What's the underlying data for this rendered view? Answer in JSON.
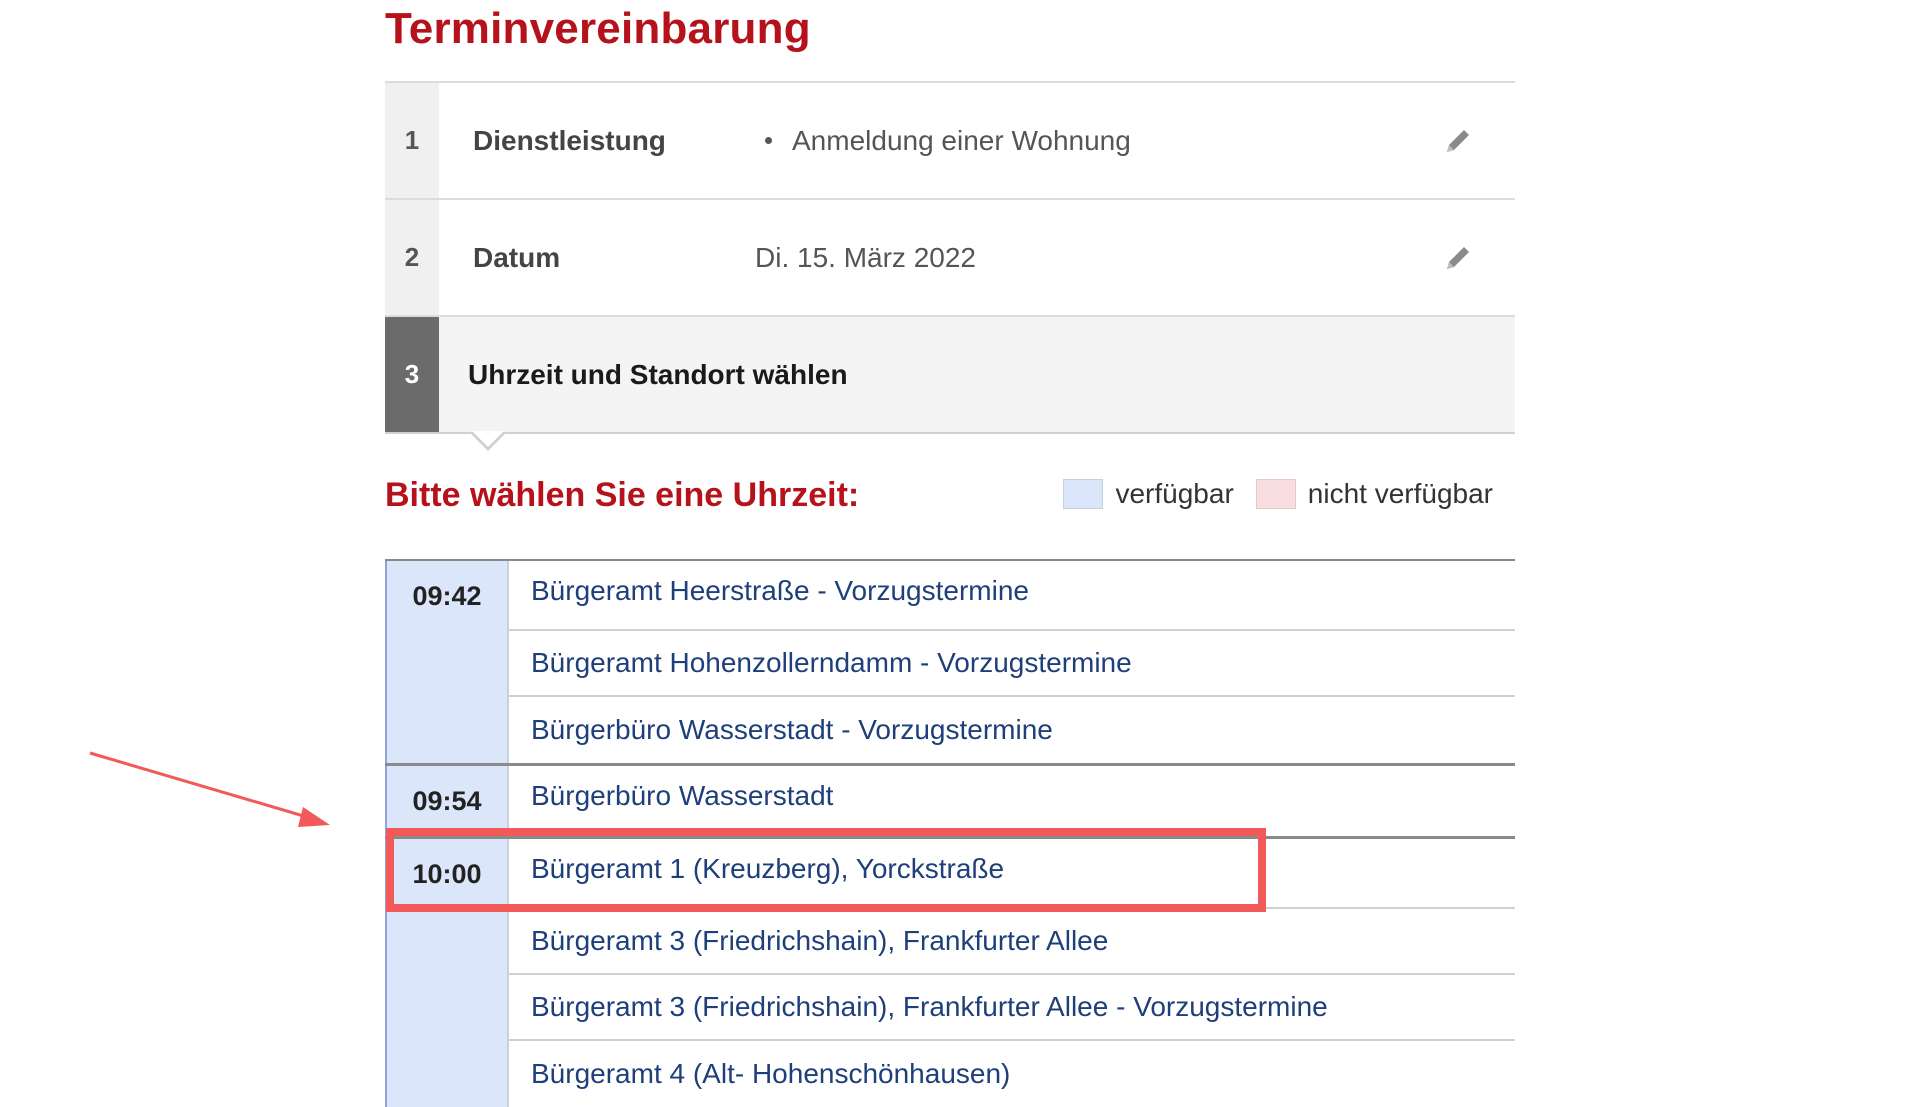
{
  "page": {
    "title": "Terminvereinbarung"
  },
  "steps": [
    {
      "number": "1",
      "label": "Dienstleistung",
      "value": "Anmeldung einer Wohnung"
    },
    {
      "number": "2",
      "label": "Datum",
      "value": "Di. 15. März 2022"
    },
    {
      "number": "3",
      "label": "Uhrzeit und Standort wählen"
    }
  ],
  "selection": {
    "heading": "Bitte wählen Sie eine Uhrzeit:",
    "legend": {
      "available": "verfügbar",
      "unavailable": "nicht verfügbar"
    }
  },
  "slots": [
    {
      "time": "09:42",
      "places": [
        "Bürgeramt Heerstraße - Vorzugstermine",
        "Bürgeramt Hohenzollerndamm - Vorzugstermine",
        "Bürgerbüro Wasserstadt - Vorzugstermine"
      ]
    },
    {
      "time": "09:54",
      "places": [
        "Bürgerbüro Wasserstadt"
      ]
    },
    {
      "time": "10:00",
      "places": [
        "Bürgeramt 1 (Kreuzberg), Yorckstraße",
        "Bürgeramt 3 (Friedrichshain), Frankfurter Allee",
        "Bürgeramt 3 (Friedrichshain), Frankfurter Allee - Vorzugstermine",
        "Bürgeramt 4 (Alt- Hohenschönhausen)"
      ]
    }
  ],
  "colors": {
    "brand_red": "#b5121b",
    "link_blue": "#1f3f7a",
    "available": "#dce6fb",
    "unavailable": "#f8dede",
    "annotation": "#f25a5a"
  },
  "icons": {
    "edit": "pencil-icon",
    "annotation": "arrow-icon"
  }
}
